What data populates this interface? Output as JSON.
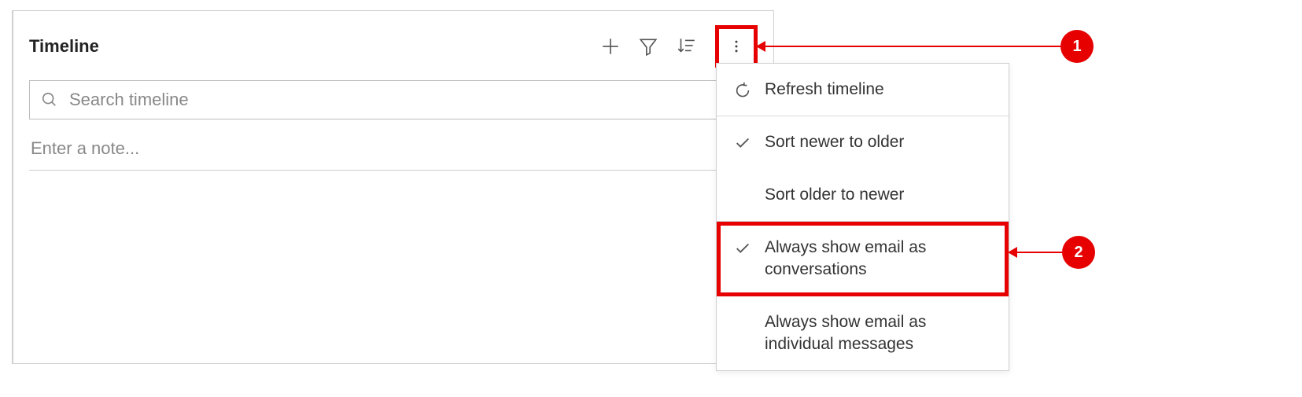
{
  "timeline": {
    "title": "Timeline",
    "search_placeholder": "Search timeline",
    "note_placeholder": "Enter a note..."
  },
  "menu": {
    "items": [
      {
        "label": "Refresh timeline",
        "icon": "refresh"
      },
      {
        "label": "Sort newer to older",
        "icon": "check"
      },
      {
        "label": "Sort older to newer",
        "icon": ""
      },
      {
        "label": "Always show email as conversations",
        "icon": "check"
      },
      {
        "label": "Always show email as individual messages",
        "icon": ""
      }
    ]
  },
  "callouts": {
    "one": "1",
    "two": "2"
  }
}
